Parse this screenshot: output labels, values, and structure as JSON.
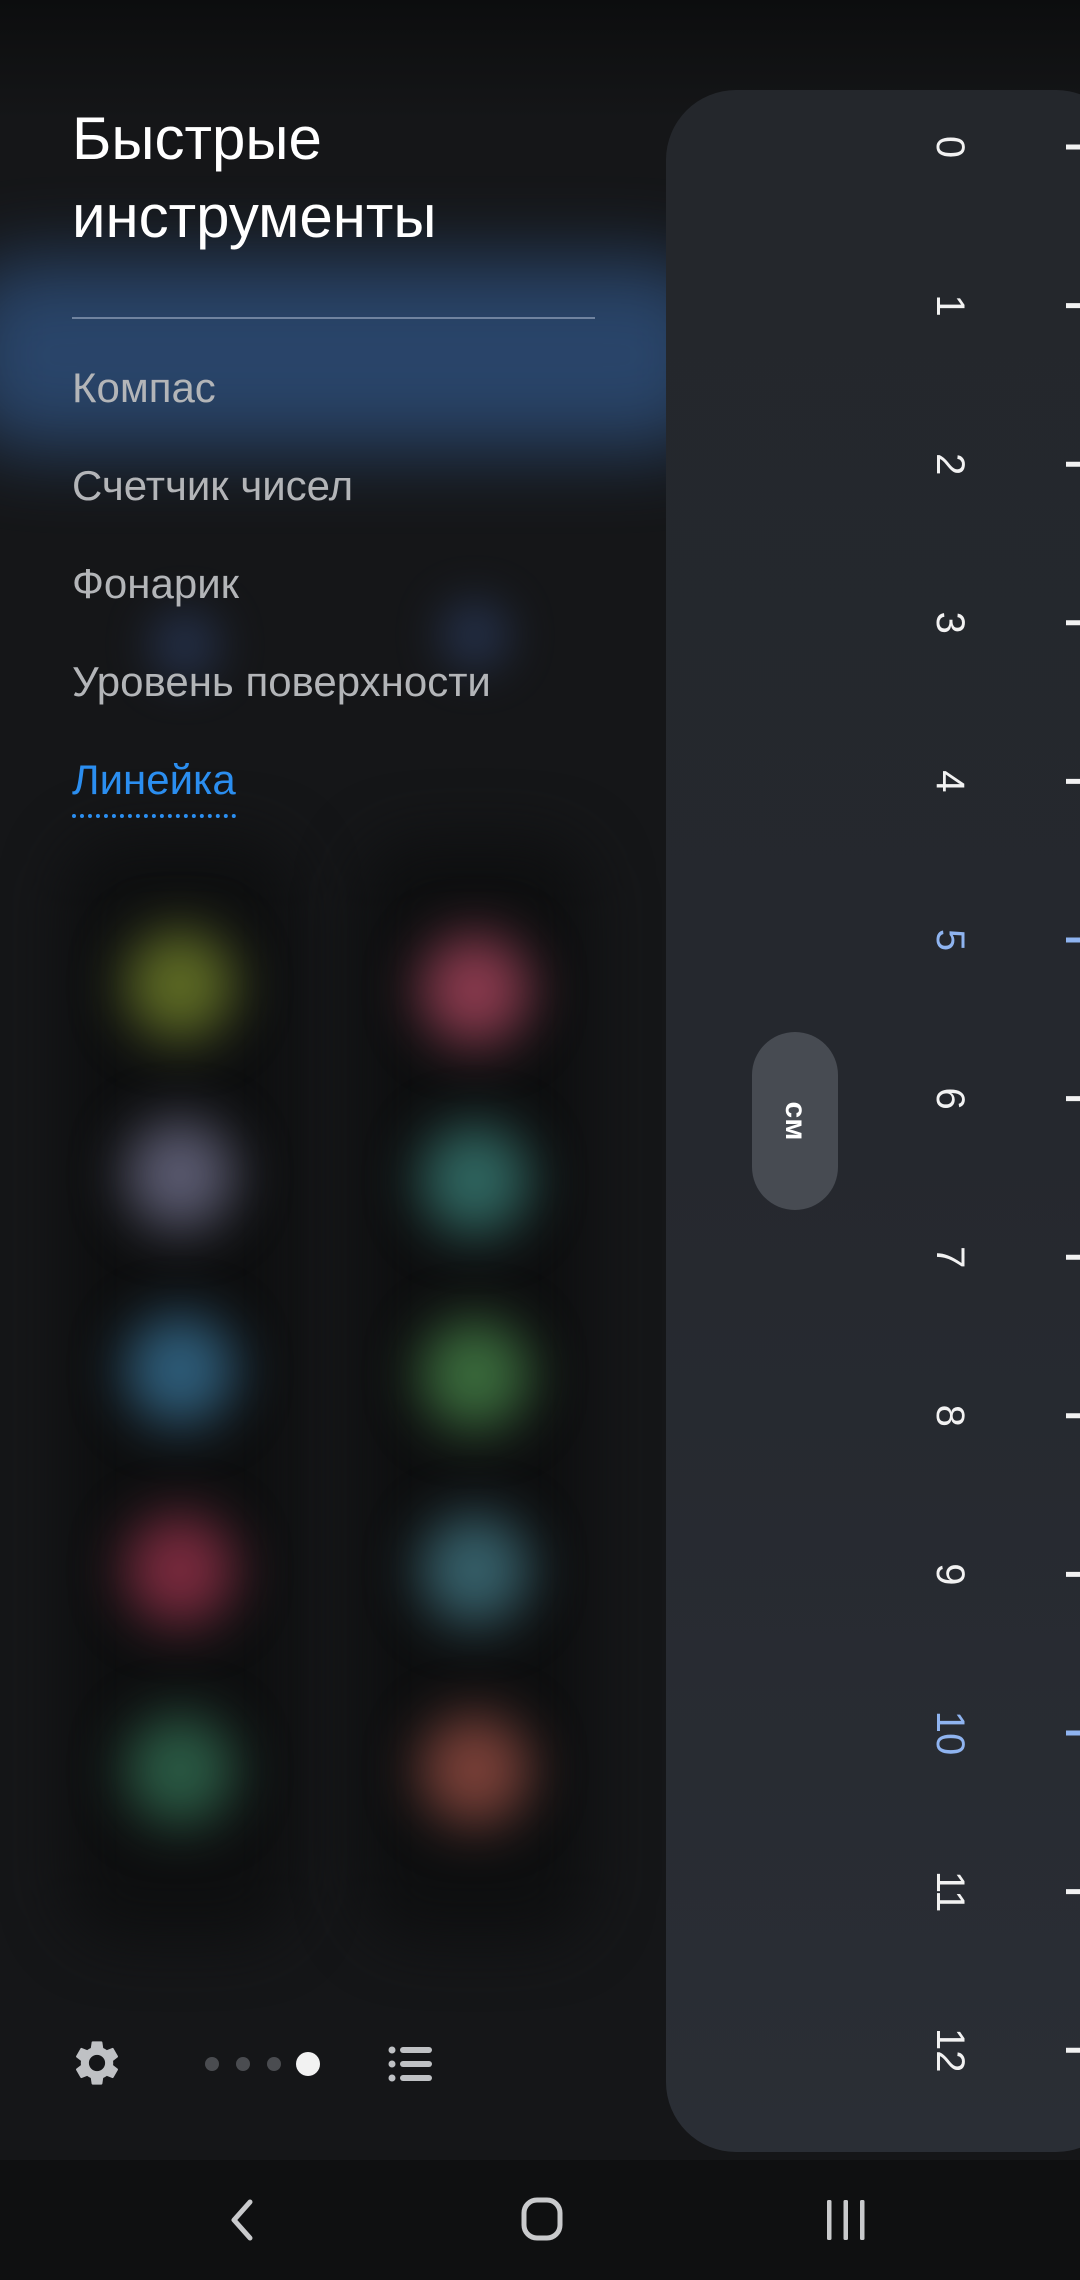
{
  "panel": {
    "title": "Быстрые\nинструменты",
    "tools": [
      "Компас",
      "Счетчик чисел",
      "Фонарик",
      "Уровень поверхности"
    ],
    "active_tool": "Линейка",
    "active_color": "#2b8ef0",
    "settings_icon": "gear-icon",
    "list_icon": "list-icon",
    "page_indicator": {
      "count": 4,
      "current": 4
    }
  },
  "ruler": {
    "unit": "см",
    "labels": [
      "0",
      "1",
      "2",
      "3",
      "4",
      "5",
      "6",
      "7",
      "8",
      "9",
      "10",
      "11",
      "12"
    ],
    "highlighted_labels": [
      "5",
      "10"
    ],
    "highlight_color": "#8fb4f0"
  },
  "nav": {
    "back_icon": "back-chevron-icon",
    "home_icon": "home-icon",
    "recents_icon": "recents-icon"
  }
}
